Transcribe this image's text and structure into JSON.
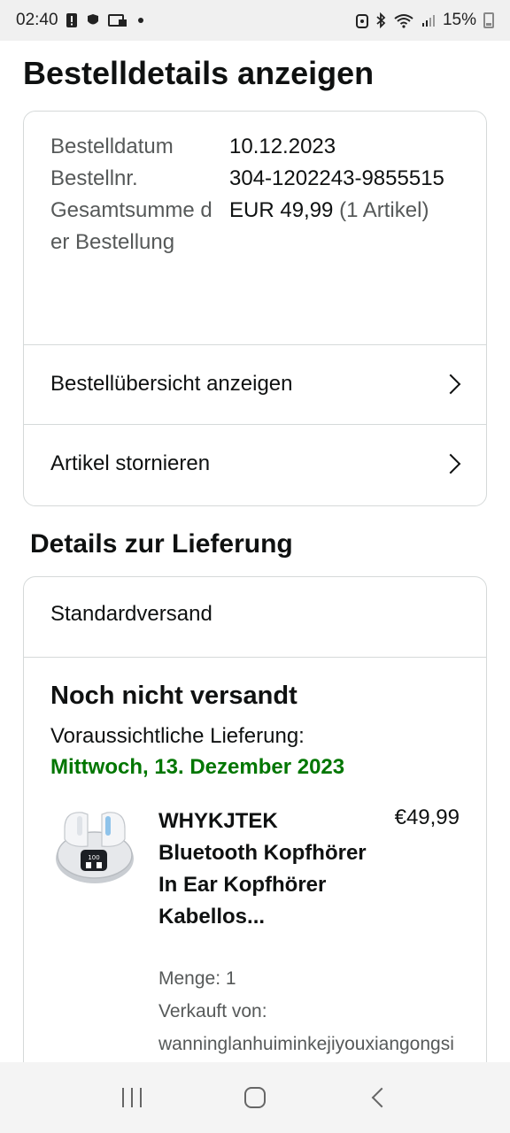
{
  "status_bar": {
    "time": "02:40",
    "battery": "15%",
    "icons": [
      "alert-icon",
      "app-icon",
      "cast-icon",
      "notification-dot",
      "alarm-icon",
      "bluetooth-icon",
      "wifi-icon",
      "signal-icon",
      "battery-icon"
    ]
  },
  "page": {
    "title": "Bestelldetails anzeigen"
  },
  "order": {
    "date_label": "Bestelldatum",
    "date_value": "10.12.2023",
    "number_label": "Bestellnr.",
    "number_value": "304-1202243-9855515",
    "total_label": "Gesamtsumme der Bestellung",
    "total_value": "EUR 49,99",
    "total_items": "(1 Artikel)",
    "links": {
      "overview": "Bestellübersicht anzeigen",
      "cancel": "Artikel stornieren"
    }
  },
  "delivery": {
    "section_title": "Details zur Lieferung",
    "method": "Standardversand",
    "status": "Noch nicht versandt",
    "eta_label": "Voraussichtliche Lieferung:",
    "eta_date": "Mittwoch, 13. Dezember 2023",
    "eta_color": "#007600"
  },
  "product": {
    "name": "WHYKJTEK Bluetooth Kopfhörer In Ear Kopfhörer Kabellos...",
    "price": "€49,99",
    "quantity": "Menge: 1",
    "sold_by_label": "Verkauft von:",
    "sold_by_value": "wanninglanhuiminkejiyouxiangongsi",
    "case_display": "100"
  },
  "nav": {
    "recents_icon": "recents-icon",
    "home_icon": "home-icon",
    "back_icon": "back-icon"
  }
}
